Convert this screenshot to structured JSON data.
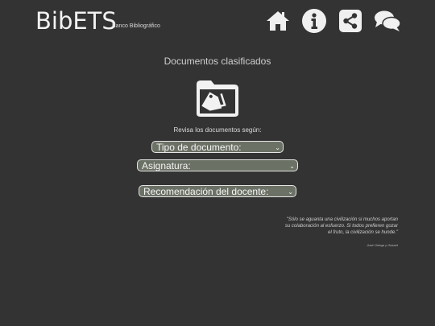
{
  "header": {
    "logo": "BibETS",
    "logo_subtitle": "Banco Bibliográfico",
    "nav": [
      {
        "icon": "home-icon"
      },
      {
        "icon": "info-icon"
      },
      {
        "icon": "share-icon"
      },
      {
        "icon": "chat-icon"
      }
    ]
  },
  "main": {
    "title": "Documentos clasificados",
    "folder_icon": "folder-tag-icon",
    "review_label": "Revisa los documentos según:",
    "selects": [
      {
        "label": "Tipo de documento:"
      },
      {
        "label": "Asignatura:"
      },
      {
        "label": "Recomendación del docente:"
      }
    ]
  },
  "quote": {
    "text": "\"Sólo se aguanta una civilización si muchos aportan su colaboración al esfuerzo. Si todos prefieren gozar el fruto, la civilización se hunde.\"",
    "author": "José Ortega y Gasset"
  },
  "colors": {
    "background": "#333333",
    "select_bg": "#6b7165",
    "text": "#e6e6e6"
  }
}
